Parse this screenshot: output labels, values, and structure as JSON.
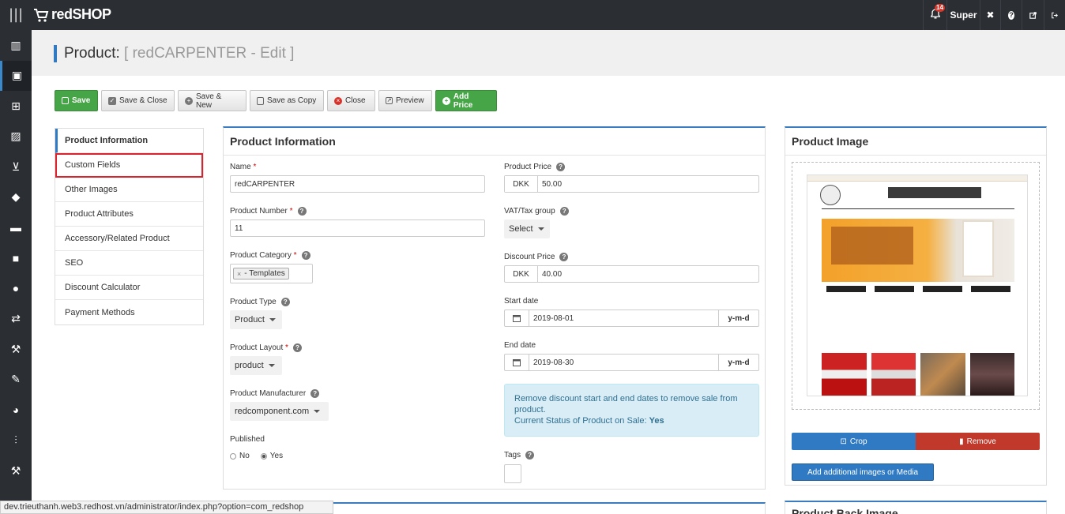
{
  "topbar": {
    "brand": "redSHOP",
    "notifications": "14",
    "user": "Super"
  },
  "sidebar": {
    "icons": [
      "chart-icon",
      "briefcase-icon",
      "sitemap-icon",
      "image-icon",
      "cart-icon",
      "tag-icon",
      "comment-icon",
      "truck-icon",
      "user-icon",
      "exchange-icon",
      "gavel-icon",
      "pencil-icon",
      "pie-chart-icon",
      "sliders-icon",
      "hammer-icon"
    ]
  },
  "page": {
    "title_prefix": "Product:",
    "title_suffix": "[ redCARPENTER - Edit ]"
  },
  "toolbar": {
    "save": "Save",
    "save_close": "Save & Close",
    "save_new": "Save & New",
    "save_copy": "Save as Copy",
    "close": "Close",
    "preview": "Preview",
    "add_price": "Add Price"
  },
  "tabs": [
    {
      "label": "Product Information"
    },
    {
      "label": "Custom Fields"
    },
    {
      "label": "Other Images"
    },
    {
      "label": "Product Attributes"
    },
    {
      "label": "Accessory/Related Product"
    },
    {
      "label": "SEO"
    },
    {
      "label": "Discount Calculator"
    },
    {
      "label": "Payment Methods"
    }
  ],
  "info": {
    "heading": "Product Information",
    "name_label": "Name",
    "name_value": "redCARPENTER",
    "number_label": "Product Number",
    "number_value": "11",
    "category_label": "Product Category",
    "category_tag": "- Templates",
    "type_label": "Product Type",
    "type_value": "Product",
    "layout_label": "Product Layout",
    "layout_value": "product",
    "manufacturer_label": "Product Manufacturer",
    "manufacturer_value": "redcomponent.com",
    "published_label": "Published",
    "no_label": "No",
    "yes_label": "Yes",
    "price_label": "Product Price",
    "currency": "DKK",
    "price_value": "50.00",
    "vat_label": "VAT/Tax group",
    "vat_value": "Select",
    "discount_label": "Discount Price",
    "discount_value": "40.00",
    "start_label": "Start date",
    "start_value": "2019-08-01",
    "date_format": "y-m-d",
    "end_label": "End date",
    "end_value": "2019-08-30",
    "alert_text": "Remove discount start and end dates to remove sale from product.",
    "alert_status_label": "Current Status of Product on Sale:",
    "alert_status_value": "Yes",
    "tags_label": "Tags"
  },
  "image_panel": {
    "heading": "Product Image",
    "crop": "Crop",
    "remove": "Remove",
    "add_media": "Add additional images or Media"
  },
  "back_image_panel": {
    "heading": "Product Back Image"
  },
  "status_url": "dev.trieuthanh.web3.redhost.vn/administrator/index.php?option=com_redshop"
}
